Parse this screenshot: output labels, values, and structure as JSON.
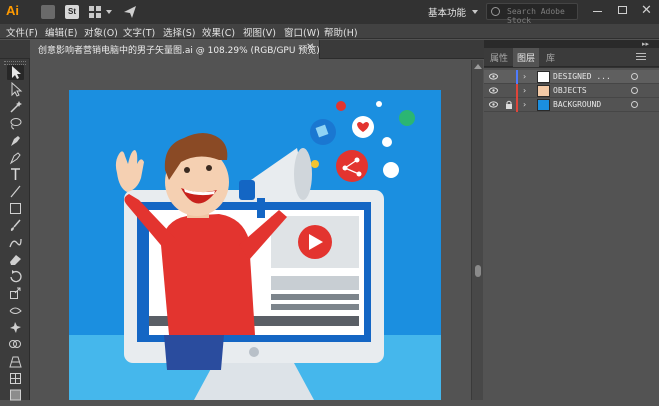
{
  "app": {
    "logo": "Ai",
    "bridge_icon": "bridge-icon",
    "stock_badge": "St",
    "workspace_label": "基本功能",
    "stock_search_placeholder": "Search Adobe Stock"
  },
  "menu": [
    {
      "label": "文件(F)"
    },
    {
      "label": "编辑(E)"
    },
    {
      "label": "对象(O)"
    },
    {
      "label": "文字(T)"
    },
    {
      "label": "选择(S)"
    },
    {
      "label": "效果(C)"
    },
    {
      "label": "视图(V)"
    },
    {
      "label": "窗口(W)"
    },
    {
      "label": "帮助(H)"
    }
  ],
  "document": {
    "tab_title": "创意影响者营销电脑中的男子矢量图.ai @ 108.29% (RGB/GPU 预览)",
    "close_glyph": "✕"
  },
  "panels": {
    "tabs": [
      {
        "label": "属性"
      },
      {
        "label": "图层"
      },
      {
        "label": "库"
      }
    ],
    "collapse_glyph": "▸▸",
    "layers": [
      {
        "name": "DESIGNED ...",
        "color": "#4f7cff",
        "locked": false
      },
      {
        "name": "OBJECTS",
        "color": "#e0453a",
        "locked": false
      },
      {
        "name": "BACKGROUND",
        "color": "#e0453a",
        "locked": true
      }
    ]
  },
  "colors": {
    "accent_orange": "#ff9a00",
    "artwork_blue": "#1d8fe0",
    "artwork_red": "#e3342f"
  }
}
